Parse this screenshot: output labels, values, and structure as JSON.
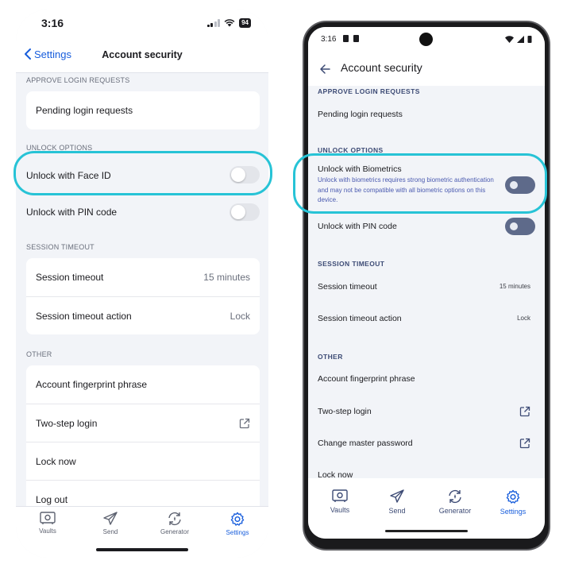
{
  "colors": {
    "accent": "#175ddc",
    "highlight": "#27c3d6"
  },
  "ios": {
    "time": "3:16",
    "battery": "94",
    "back_label": "Settings",
    "title": "Account security",
    "sections": {
      "approve": "APPROVE LOGIN REQUESTS",
      "unlock": "UNLOCK OPTIONS",
      "timeout": "SESSION TIMEOUT",
      "other": "OTHER"
    },
    "pending": "Pending login requests",
    "face_id": "Unlock with Face ID",
    "pin": "Unlock with PIN code",
    "session_timeout": "Session timeout",
    "session_timeout_value": "15 minutes",
    "timeout_action": "Session timeout action",
    "timeout_action_value": "Lock",
    "fingerprint": "Account fingerprint phrase",
    "two_step": "Two-step login",
    "lock_now": "Lock now",
    "log_out": "Log out",
    "tabs": [
      "Vaults",
      "Send",
      "Generator",
      "Settings"
    ]
  },
  "android": {
    "time": "3:16",
    "title": "Account security",
    "sections": {
      "approve": "APPROVE LOGIN REQUESTS",
      "unlock": "UNLOCK OPTIONS",
      "timeout": "SESSION TIMEOUT",
      "other": "OTHER"
    },
    "pending": "Pending login requests",
    "biometrics": "Unlock with Biometrics",
    "biometrics_desc": "Unlock with biometrics requires strong biometric authentication and may not be compatible with all biometric options on this device.",
    "pin": "Unlock with PIN code",
    "session_timeout": "Session timeout",
    "session_timeout_value": "15 minutes",
    "timeout_action": "Session timeout action",
    "timeout_action_value": "Lock",
    "fingerprint": "Account fingerprint phrase",
    "two_step": "Two-step login",
    "change_master": "Change master password",
    "lock_now": "Lock now",
    "tabs": [
      "Vaults",
      "Send",
      "Generator",
      "Settings"
    ]
  }
}
